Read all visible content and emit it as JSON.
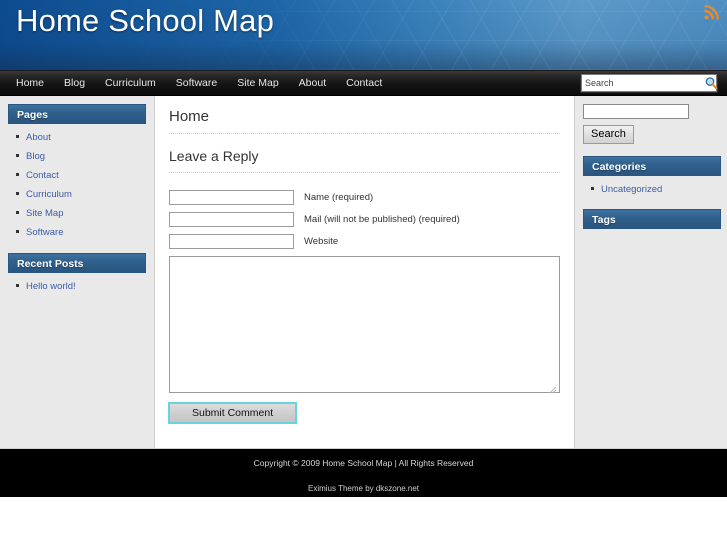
{
  "site": {
    "title": "Home School Map",
    "rss_icon": "rss-icon"
  },
  "nav": {
    "items": [
      {
        "label": "Home"
      },
      {
        "label": "Blog"
      },
      {
        "label": "Curriculum"
      },
      {
        "label": "Software"
      },
      {
        "label": "Site Map"
      },
      {
        "label": "About"
      },
      {
        "label": "Contact"
      }
    ],
    "search": {
      "value": "Search",
      "placeholder": "Search",
      "icon": "magnifier-icon"
    }
  },
  "sidebar_left": {
    "widgets": [
      {
        "title": "Pages",
        "items": [
          {
            "label": "About"
          },
          {
            "label": "Blog"
          },
          {
            "label": "Contact"
          },
          {
            "label": "Curriculum"
          },
          {
            "label": "Site Map"
          },
          {
            "label": "Software"
          }
        ]
      },
      {
        "title": "Recent Posts",
        "items": [
          {
            "label": "Hello world!"
          }
        ]
      }
    ]
  },
  "sidebar_right": {
    "search": {
      "value": "",
      "placeholder": "",
      "button_label": "Search"
    },
    "widgets": [
      {
        "title": "Categories",
        "items": [
          {
            "label": "Uncategorized"
          }
        ]
      },
      {
        "title": "Tags",
        "items": []
      }
    ]
  },
  "main": {
    "post_title": "Home",
    "reply_title": "Leave a Reply",
    "form": {
      "fields": [
        {
          "name": "author",
          "value": "",
          "label": "Name (required)"
        },
        {
          "name": "email",
          "value": "",
          "label": "Mail (will not be published) (required)"
        },
        {
          "name": "url",
          "value": "",
          "label": "Website"
        }
      ],
      "comment_value": "",
      "submit_label": "Submit Comment"
    }
  },
  "footer": {
    "copyright": "Copyright © 2009 Home School Map | All Rights Reserved",
    "credit": "Eximius Theme by dkszone.net"
  },
  "colors": {
    "header_blue": "#1e66a8",
    "widget_header": "#2f5f8c",
    "link_blue": "#3b5ca8",
    "nav_black": "#141414",
    "footer_black": "#000000",
    "focus_cyan": "#69d3e0",
    "rss_orange": "#f08a24"
  }
}
